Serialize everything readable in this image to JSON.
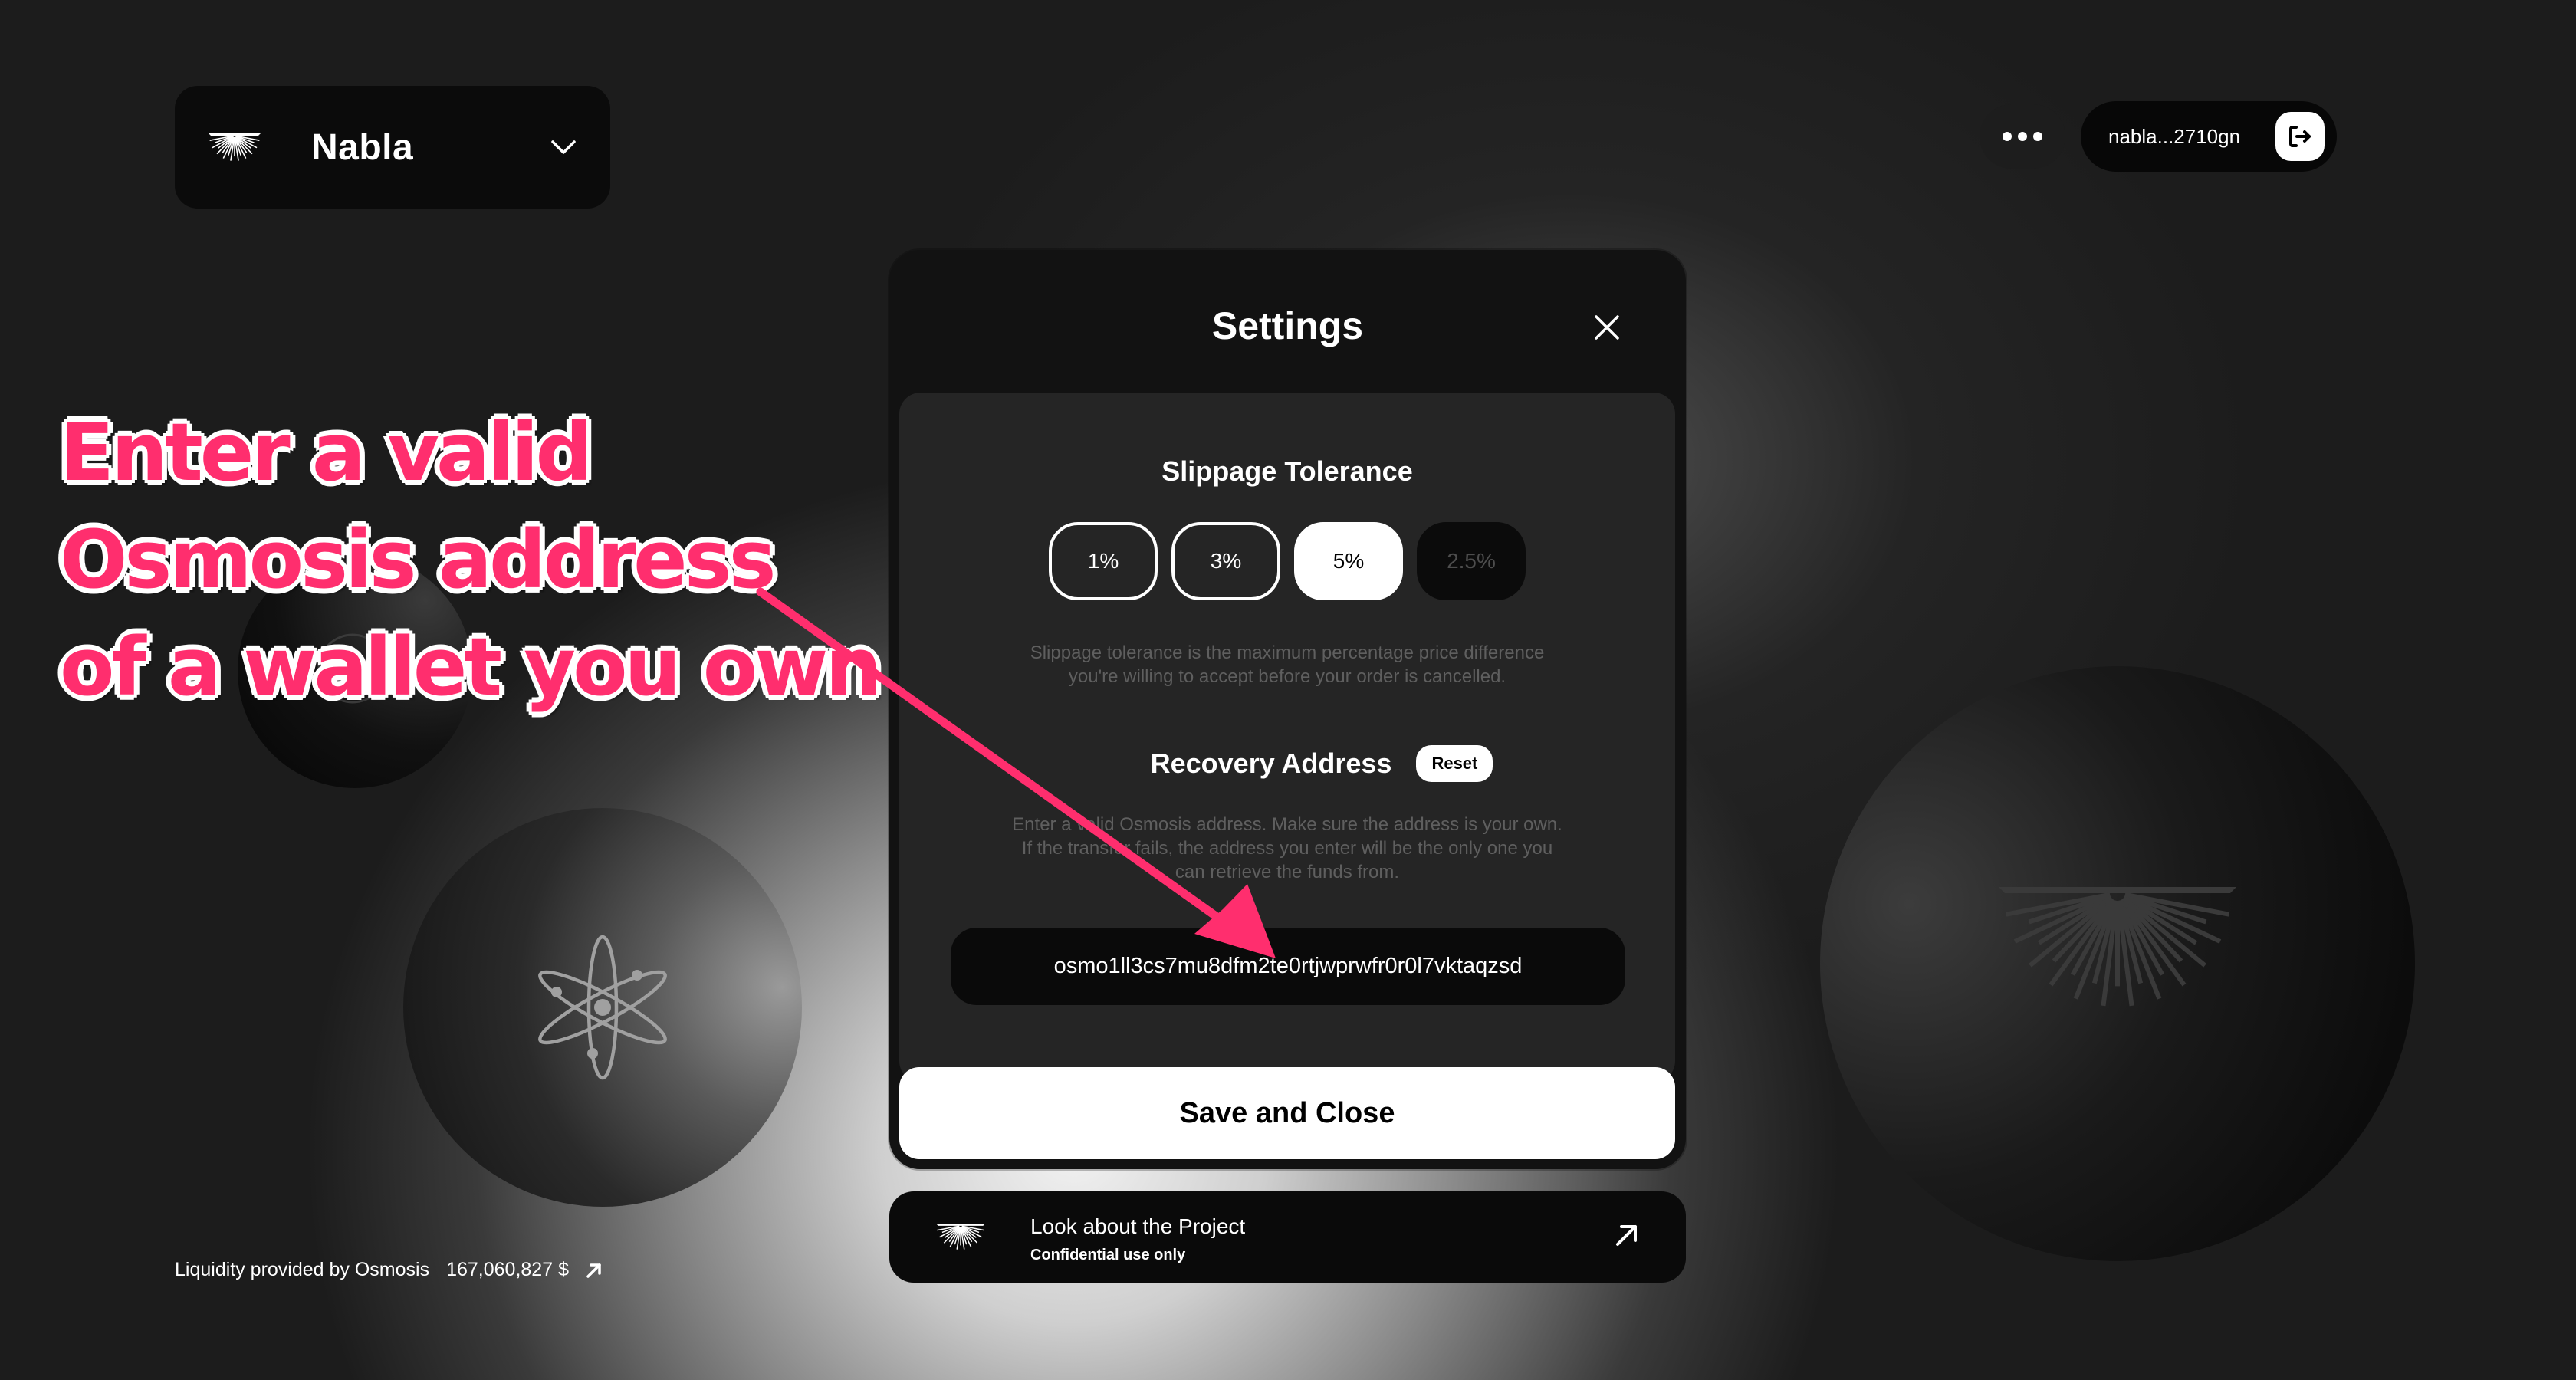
{
  "header": {
    "network": {
      "name": "Nabla",
      "logo_icon": "nabla-logo-icon",
      "dropdown_icon": "chevron-down-icon"
    },
    "menu_icon": "more-horizontal-icon",
    "wallet": {
      "address": "nabla...2710gn",
      "logout_icon": "logout-icon"
    }
  },
  "settings": {
    "title": "Settings",
    "close_icon": "close-icon",
    "slippage": {
      "title": "Slippage Tolerance",
      "options": [
        {
          "label": "1%",
          "state": "default"
        },
        {
          "label": "3%",
          "state": "default"
        },
        {
          "label": "5%",
          "state": "selected"
        }
      ],
      "custom_placeholder": "2.5%",
      "description_line1": "Slippage tolerance is the maximum percentage price difference",
      "description_line2": "you're willing to accept before your order is cancelled."
    },
    "recovery": {
      "title": "Recovery Address",
      "reset_label": "Reset",
      "description_line1": "Enter a valid Osmosis address. Make sure the address is your own.",
      "description_line2": "If the transfer fails, the address you enter will be the only one you",
      "description_line3": "can retrieve the funds from.",
      "address_value": "osmo1ll3cs7mu8dfm2te0rtjwprwfr0r0l7vktaqzsd"
    },
    "save_label": "Save and Close"
  },
  "project_card": {
    "title": "Look about the Project",
    "subtitle": "Confidential use only",
    "link_icon": "arrow-up-right-icon"
  },
  "footer": {
    "liquidity_label": "Liquidity provided by Osmosis",
    "liquidity_value": "167,060,827 $",
    "link_icon": "arrow-up-right-icon"
  },
  "decor": {
    "circle_icons": [
      "osmosis-logo-icon",
      "cosmos-atom-icon",
      "nabla-logo-icon"
    ]
  },
  "annotation": {
    "lines": [
      "Enter a valid",
      "Osmosis address",
      "of a wallet you own"
    ],
    "color": "#ff2e6e"
  },
  "colors": {
    "accent": "#ff2e6e",
    "panel_bg": "#121212",
    "card_bg": "#252525",
    "muted_text": "#5f5f5f"
  }
}
